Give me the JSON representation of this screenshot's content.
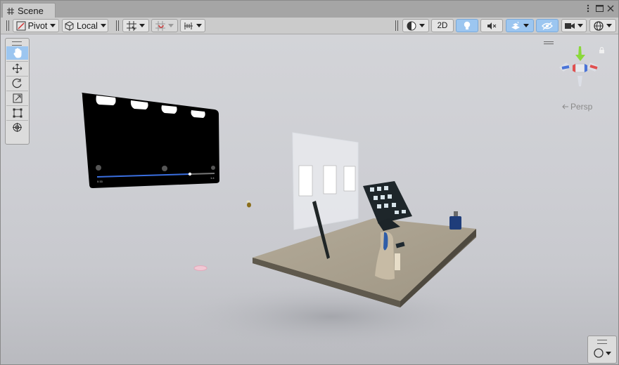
{
  "window": {
    "tab_label": "Scene",
    "tab_icon": "grid-icon",
    "controls": [
      "kebab-menu-icon",
      "maximize-icon",
      "close-icon"
    ]
  },
  "toolbar": {
    "pivot_label": "Pivot",
    "local_label": "Local",
    "mode_2d_label": "2D",
    "active_color": "#9cc6f0",
    "icons": [
      "grid-snap-icon",
      "increment-snap-icon",
      "ruler-icon",
      "shading-mode-icon",
      "lighting-icon",
      "audio-mute-icon",
      "effects-icon",
      "hidden-objects-icon",
      "camera-icon",
      "gizmos-icon"
    ]
  },
  "tools": [
    "hand-tool-icon",
    "move-tool-icon",
    "rotate-tool-icon",
    "scale-tool-icon",
    "rect-tool-icon",
    "transform-tool-icon"
  ],
  "gizmo": {
    "projection_label": "Persp",
    "axis_colors": {
      "x": "#e05050",
      "y": "#8ad83a",
      "z": "#4a74d8"
    }
  },
  "scene": {
    "video_player": {
      "time_elapsed": "0:33",
      "time_total": "1:4"
    },
    "background_color": "#cdced3"
  }
}
